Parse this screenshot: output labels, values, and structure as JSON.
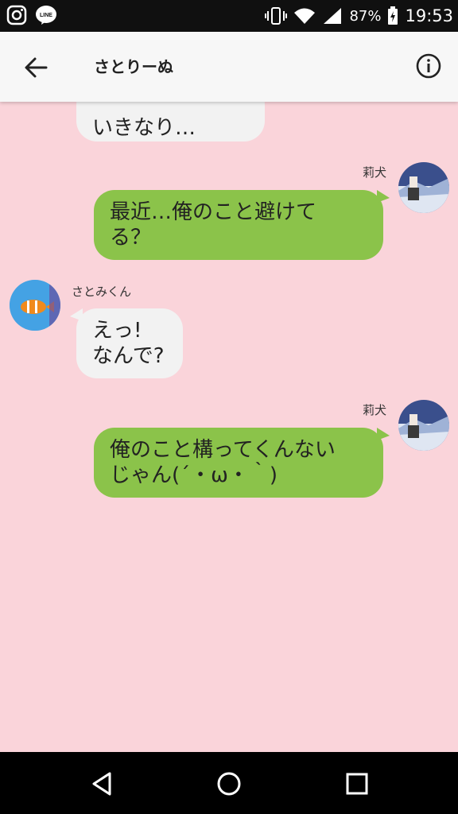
{
  "status_bar": {
    "battery": "87%",
    "time": "19:53",
    "icons": [
      "instagram-icon",
      "line-icon",
      "vibrate-icon",
      "wifi-icon",
      "signal-icon",
      "battery-icon"
    ]
  },
  "header": {
    "title": "さとりーぬ",
    "icons": [
      "back-arrow-icon",
      "info-icon"
    ]
  },
  "messages": [
    {
      "side": "in",
      "sender": "",
      "line1": "",
      "line2": "いきなり…"
    },
    {
      "side": "out",
      "sender": "莉犬",
      "line1": "最近…俺のこと避けて",
      "line2": "る？"
    },
    {
      "side": "in",
      "sender": "さとみくん",
      "line1": "えっ!",
      "line2": "なんで?"
    },
    {
      "side": "out",
      "sender": "莉犬",
      "line1": "俺のこと構ってくんない",
      "line2": "じゃん(´・ω・｀)"
    }
  ],
  "nav_bar": {
    "icons": [
      "back-triangle-icon",
      "home-circle-icon",
      "recents-square-icon"
    ]
  }
}
